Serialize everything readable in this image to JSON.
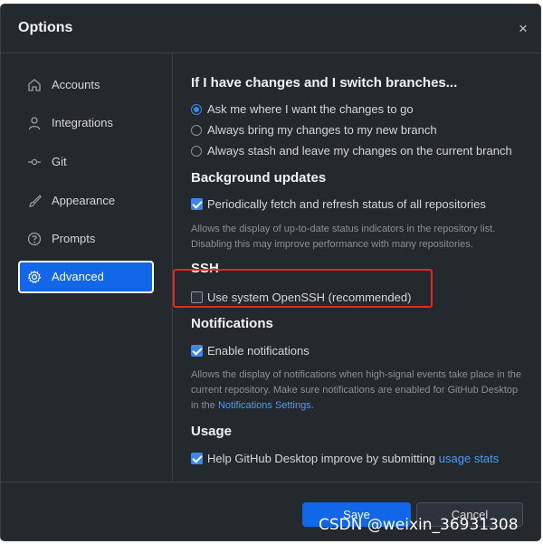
{
  "dialog": {
    "title": "Options",
    "close_glyph": "×"
  },
  "sidebar": {
    "items": [
      {
        "label": "Accounts",
        "icon": "home-icon"
      },
      {
        "label": "Integrations",
        "icon": "person-icon"
      },
      {
        "label": "Git",
        "icon": "git-commit-icon"
      },
      {
        "label": "Appearance",
        "icon": "paintbrush-icon"
      },
      {
        "label": "Prompts",
        "icon": "question-circle-icon"
      },
      {
        "label": "Advanced",
        "icon": "gear-icon",
        "active": true
      }
    ]
  },
  "branches": {
    "title": "If I have changes and I switch branches...",
    "options": [
      {
        "label": "Ask me where I want the changes to go",
        "selected": true
      },
      {
        "label": "Always bring my changes to my new branch",
        "selected": false
      },
      {
        "label": "Always stash and leave my changes on the current branch",
        "selected": false
      }
    ]
  },
  "background": {
    "title": "Background updates",
    "fetch_label": "Periodically fetch and refresh status of all repositories",
    "fetch_checked": true,
    "description": "Allows the display of up-to-date status indicators in the repository list. Disabling this may improve performance with many repositories."
  },
  "ssh": {
    "title": "SSH",
    "openssh_label": "Use system OpenSSH (recommended)",
    "openssh_checked": false
  },
  "notifications": {
    "title": "Notifications",
    "enable_label": "Enable notifications",
    "enable_checked": true,
    "description": "Allows the display of notifications when high-signal events take place in the current repository. Make sure notifications are enabled for GitHub Desktop in the ",
    "settings_link": "Notifications Settings",
    "description_end": "."
  },
  "usage": {
    "title": "Usage",
    "help_label": "Help GitHub Desktop improve by submitting ",
    "stats_link": "usage stats",
    "help_checked": true
  },
  "footer": {
    "save_label": "Save",
    "cancel_label": "Cancel"
  },
  "watermark": "CSDN @weixin_36931308",
  "colors": {
    "accent": "#1167e8",
    "highlight": "#e52621",
    "link": "#4c9cf5"
  }
}
